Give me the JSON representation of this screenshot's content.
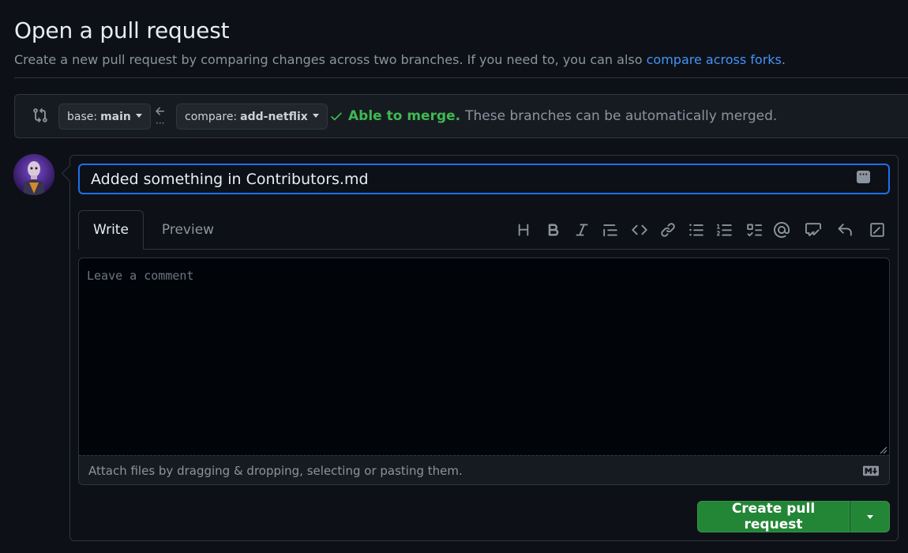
{
  "header": {
    "title": "Open a pull request",
    "subtitle_text": "Create a new pull request by comparing changes across two branches. If you need to, you can also ",
    "subtitle_link": "compare across forks",
    "subtitle_end": "."
  },
  "range": {
    "base_label": "base:",
    "base_value": "main",
    "compare_label": "compare:",
    "compare_value": "add-netflix",
    "merge_status": "Able to merge.",
    "merge_desc": "These branches can be automatically merged."
  },
  "form": {
    "title_value": "Added something in Contributors.md",
    "tabs": [
      {
        "label": "Write"
      },
      {
        "label": "Preview"
      }
    ],
    "toolbar": [
      "heading-icon",
      "bold-icon",
      "italic-icon",
      "quote-icon",
      "code-icon",
      "link-icon",
      "unordered-list-icon",
      "ordered-list-icon",
      "task-list-icon",
      "mention-icon",
      "reference-icon",
      "reply-icon",
      "diff-icon"
    ],
    "comment_placeholder": "Leave a comment",
    "attach_text": "Attach files by dragging & dropping, selecting or pasting them.",
    "submit_label": "Create pull request"
  },
  "colors": {
    "background": "#0d1117",
    "accent_link": "#4493f8",
    "success": "#3fb950",
    "primary_button": "#238636",
    "focus_border": "#1f6feb"
  }
}
